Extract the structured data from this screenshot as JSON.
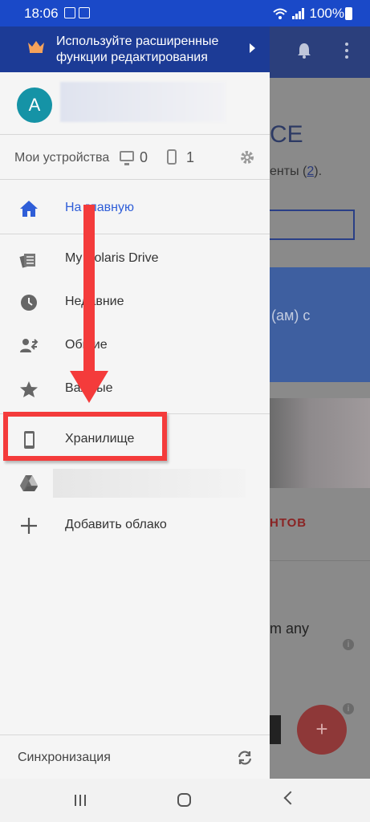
{
  "status_bar": {
    "time": "18:06",
    "battery": "100%"
  },
  "banner": {
    "line1": "Используйте расширенные",
    "line2": "функции редактирования"
  },
  "account": {
    "avatar_letter": "A"
  },
  "devices": {
    "label": "Мои устройства",
    "pc_count": "0",
    "mobile_count": "1"
  },
  "menu": {
    "home": "На главную",
    "drive": "My Polaris Drive",
    "recent": "Недавние",
    "shared": "Общие",
    "important": "Важные",
    "storage": "Хранилище",
    "add_cloud": "Добавить облако"
  },
  "footer": {
    "sync_label": "Синхронизация"
  },
  "background": {
    "heading": "CE",
    "doc_text": "енты (",
    "doc_count": "2",
    "doc_close": ").",
    "card_text": "(ам) с",
    "red_text": "НТОВ",
    "any_text": "m any",
    "fab_symbol": "+"
  },
  "colors": {
    "accent": "#2f5ed8",
    "banner": "#1c3b96",
    "status_bar": "#1a49c8",
    "avatar": "#1593a6",
    "annotation": "#f43b3b"
  }
}
